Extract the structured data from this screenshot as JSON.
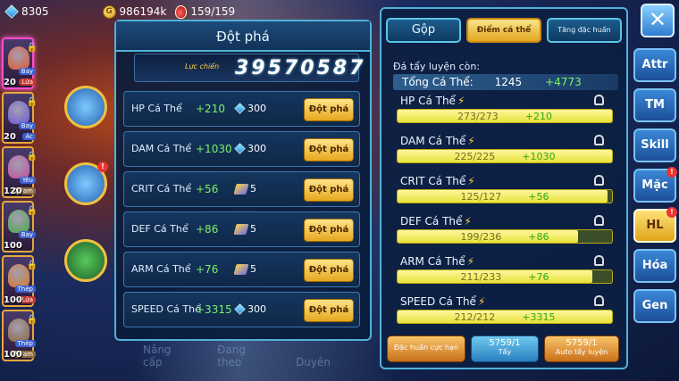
{
  "resources": {
    "gems": "8305",
    "gold": "986194k",
    "stamina": "159/159"
  },
  "left_panel": {
    "title": "Đột phá",
    "power_label": "Lực chiến",
    "power_value": "39570587",
    "rows": [
      {
        "name": "HP Cá Thể",
        "plus": "+210",
        "cost": "300",
        "cost_type": "gem",
        "button": "Đột phá"
      },
      {
        "name": "DAM Cá Thể",
        "plus": "+1030",
        "cost": "300",
        "cost_type": "gem",
        "button": "Đột phá"
      },
      {
        "name": "CRIT Cá Thể",
        "plus": "+56",
        "cost": "5",
        "cost_type": "stone",
        "button": "Đột phá"
      },
      {
        "name": "DEF Cá Thể",
        "plus": "+86",
        "cost": "5",
        "cost_type": "stone",
        "button": "Đột phá"
      },
      {
        "name": "ARM Cá Thể",
        "plus": "+76",
        "cost": "5",
        "cost_type": "stone",
        "button": "Đột phá"
      },
      {
        "name": "SPEED Cá Thể",
        "plus": "+3315",
        "cost": "300",
        "cost_type": "gem",
        "button": "Đột phá"
      }
    ],
    "bottom_tabs": [
      "Nâng cấp",
      "Đang theo",
      "Duyên"
    ]
  },
  "heroes": [
    {
      "level": "20",
      "tag": "Bay",
      "tag2": "Lửa",
      "color": "#e4572e"
    },
    {
      "level": "20",
      "tag": "Bay",
      "tag2": "Ác",
      "color": "#6b5bd8"
    },
    {
      "level": "120",
      "tag": "Yêu",
      "tag2": "Nham",
      "color": "#c24fa0"
    },
    {
      "level": "100",
      "tag": "Bay",
      "tag2": "",
      "color": "#4aa84a"
    },
    {
      "level": "100",
      "tag": "Thép",
      "tag2": "Lửa",
      "color": "#d87a2a"
    },
    {
      "level": "100",
      "tag": "Thép",
      "tag2": "Nham",
      "color": "#8c6a3e"
    }
  ],
  "tabs": {
    "gop": "Gộp",
    "diem": "Điểm cá thể",
    "tang": "Tăng đặc huấn"
  },
  "remaining_label": "Đá tẩy luyện còn:",
  "total": {
    "label": "Tổng Cá Thể:",
    "value": "1245",
    "plus": "+4773"
  },
  "stats": [
    {
      "name": "HP Cá Thể",
      "current": "273/273",
      "plus": "+210",
      "fill": 1.0
    },
    {
      "name": "DAM Cá Thể",
      "current": "225/225",
      "plus": "+1030",
      "fill": 1.0
    },
    {
      "name": "CRIT Cá Thể",
      "current": "125/127",
      "plus": "+56",
      "fill": 0.98
    },
    {
      "name": "DEF Cá Thể",
      "current": "199/236",
      "plus": "+86",
      "fill": 0.84
    },
    {
      "name": "ARM Cá Thể",
      "current": "211/233",
      "plus": "+76",
      "fill": 0.91
    },
    {
      "name": "SPEED Cá Thể",
      "current": "212/212",
      "plus": "+3315",
      "fill": 1.0
    }
  ],
  "bottom_buttons": {
    "special": "Đặc huấn cực hạn",
    "wash_count": "5759/1",
    "wash_label": "Tẩy",
    "auto_count": "5759/1",
    "auto_label": "Auto tẩy luyện"
  },
  "menu": [
    "Attr",
    "TM",
    "Skill",
    "Mặc",
    "HL",
    "Hóa",
    "Gen"
  ]
}
